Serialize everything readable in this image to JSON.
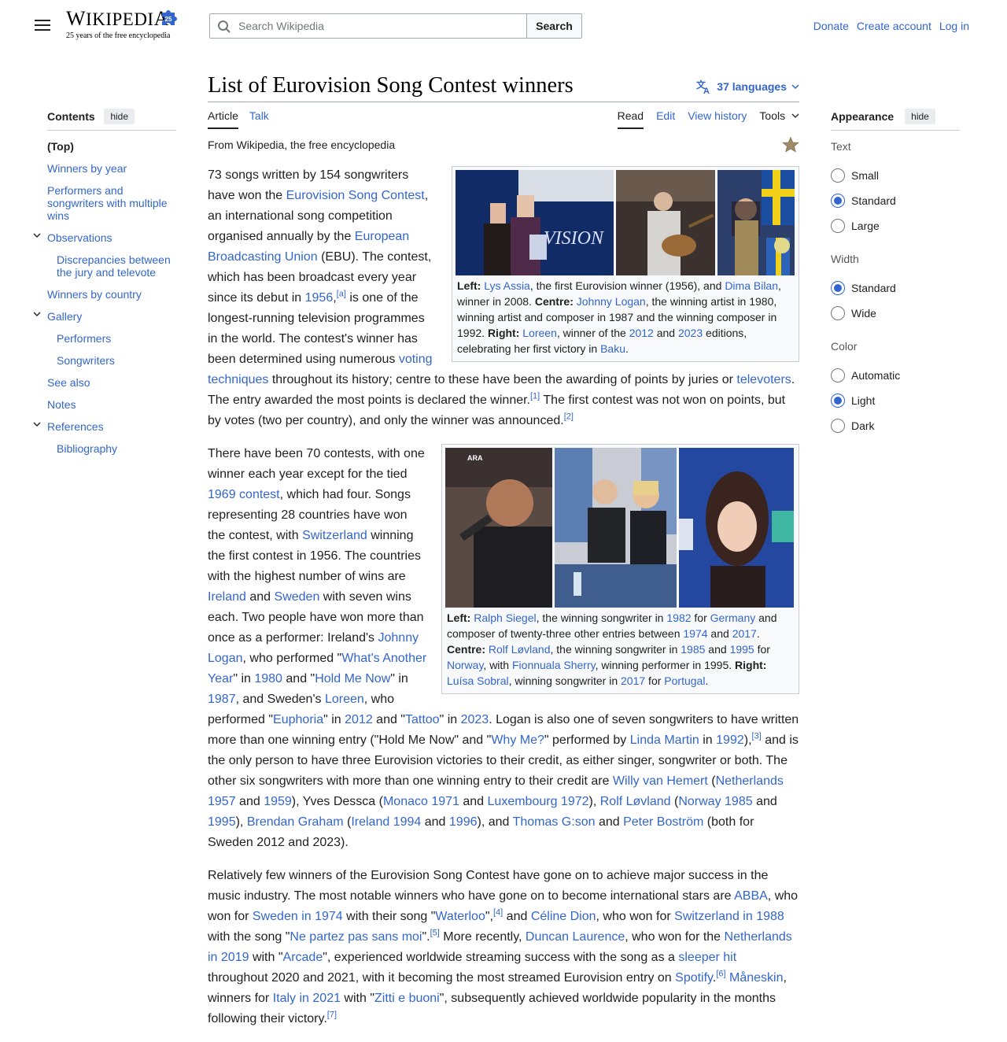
{
  "header": {
    "logo_wordmark": "Wikipedia",
    "logo_tagline": "25 years of the free encyclopedia",
    "search_placeholder": "Search Wikipedia",
    "search_button": "Search",
    "user_links": [
      "Donate",
      "Create account",
      "Log in"
    ]
  },
  "page": {
    "title": "List of Eurovision Song Contest winners",
    "languages": "37 languages",
    "tabs_left": [
      "Article",
      "Talk"
    ],
    "tabs_right": [
      "Read",
      "Edit",
      "View history",
      "Tools"
    ],
    "tagline": "From Wikipedia, the free encyclopedia"
  },
  "toc": {
    "title": "Contents",
    "hide": "hide",
    "items": [
      "(Top)",
      "Winners by year",
      "Performers and songwriters with multiple wins",
      "Observations",
      "Discrepancies between the jury and televote",
      "Winners by country",
      "Gallery",
      "Performers",
      "Songwriters",
      "See also",
      "Notes",
      "References",
      "Bibliography"
    ]
  },
  "appearance": {
    "title": "Appearance",
    "hide": "hide",
    "text_label": "Text",
    "text_options": [
      "Small",
      "Standard",
      "Large"
    ],
    "text_selected": "Standard",
    "width_label": "Width",
    "width_options": [
      "Standard",
      "Wide"
    ],
    "width_selected": "Standard",
    "color_label": "Color",
    "color_options": [
      "Automatic",
      "Light",
      "Dark"
    ],
    "color_selected": "Light"
  },
  "figure1": {
    "caption_parts": [
      "Left:",
      "Lys Assia",
      ", the first Eurovision winner (1956), and ",
      "Dima Bilan",
      ", winner in 2008. ",
      "Centre:",
      "Johnny Logan",
      ", the winning artist in 1980, winning artist and composer in 1987 and the winning composer in 1992. ",
      "Right:",
      "Loreen",
      ", winner of the ",
      "2012",
      " and ",
      "2023",
      " editions, celebrating her first victory in ",
      "Baku",
      "."
    ]
  },
  "figure2": {
    "caption_parts": [
      "Left:",
      "Ralph Siegel",
      ", the winning songwriter in ",
      "1982",
      " for ",
      "Germany",
      " and composer of twenty-three other entries between ",
      "1974",
      " and ",
      "2017",
      ". ",
      "Centre:",
      "Rolf Løvland",
      ", the winning songwriter in ",
      "1985",
      " and ",
      "1995",
      " for ",
      "Norway",
      ", with ",
      "Fionnuala Sherry",
      ", winning performer in 1995. ",
      "Right:",
      "Luísa Sobral",
      ", winning songwriter in ",
      "2017",
      " for ",
      "Portugal",
      "."
    ]
  },
  "para1": [
    "73 songs written by 154 songwriters have won the ",
    "Eurovision Song Contest",
    ", an international song competition organised annually by the ",
    "European Broadcasting Union",
    " (EBU). The contest, which has been broadcast every year since its debut in ",
    "1956",
    ",",
    "[a]",
    " is one of the longest-running television programmes in the world. The contest's winner has been determined using numerous ",
    "voting techniques",
    " throughout its history; centre to these have been the awarding of points by juries or ",
    "televoters",
    ". The entry awarded the most points is declared the winner.",
    "[1]",
    " The first contest was not won on points, but by votes (two per country), and only the winner was announced.",
    "[2]"
  ],
  "para2": [
    "There have been 70 contests, with one winner each year except for the tied ",
    "1969 contest",
    ", which had four. Songs representing 28 countries have won the contest, with ",
    "Switzerland",
    " winning the first contest in 1956. The countries with the highest number of wins are ",
    "Ireland",
    " and ",
    "Sweden",
    " with seven wins each. Two people have won more than once as a performer: Ireland's ",
    "Johnny Logan",
    ", who performed \"",
    "What's Another Year",
    "\" in ",
    "1980",
    " and \"",
    "Hold Me Now",
    "\" in ",
    "1987",
    ", and Sweden's ",
    "Loreen",
    ", who performed \"",
    "Euphoria",
    "\" in ",
    "2012",
    " and \"",
    "Tattoo",
    "\" in ",
    "2023",
    ". Logan is also one of seven songwriters to have written more than one winning entry (\"Hold Me Now\" and \"",
    "Why Me?",
    "\" performed by ",
    "Linda Martin",
    " in ",
    "1992",
    "),",
    "[3]",
    " and is the only person to have three Eurovision victories to their credit, as either singer, songwriter or both. The other six songwriters with more than one winning entry to their credit are ",
    "Willy van Hemert",
    " (",
    "Netherlands 1957",
    " and ",
    "1959",
    "), Yves Dessca (",
    "Monaco 1971",
    " and ",
    "Luxembourg 1972",
    "), ",
    "Rolf Løvland",
    " (",
    "Norway 1985",
    " and ",
    "1995",
    "), ",
    "Brendan Graham",
    " (",
    "Ireland 1994",
    " and ",
    "1996",
    "), and ",
    "Thomas G:son",
    " and ",
    "Peter Boström",
    " (both for Sweden 2012 and 2023)."
  ],
  "para3": [
    "Relatively few winners of the Eurovision Song Contest have gone on to achieve major success in the music industry. The most notable winners who have gone on to become international stars are ",
    "ABBA",
    ", who won for ",
    "Sweden in 1974",
    " with their song \"",
    "Waterloo",
    "\",",
    "[4]",
    " and ",
    "Céline Dion",
    ", who won for ",
    "Switzerland in 1988",
    " with the song \"",
    "Ne partez pas sans moi",
    "\".",
    "[5]",
    " More recently, ",
    "Duncan Laurence",
    ", who won for the ",
    "Netherlands in 2019",
    " with \"",
    "Arcade",
    "\", experienced worldwide streaming success with the song as a ",
    "sleeper hit",
    " throughout 2020 and 2021, with it becoming the most streamed Eurovision entry on ",
    "Spotify",
    ".",
    "[6]",
    " ",
    "Måneskin",
    ", winners for ",
    "Italy in 2021",
    " with \"",
    "Zitti e buoni",
    "\", subsequently achieved worldwide popularity in the months following their victory.",
    "[7]"
  ],
  "colors": {
    "link": "#3366cc",
    "text": "#202122",
    "border": "#a2a9b1",
    "accent": "#36c"
  }
}
